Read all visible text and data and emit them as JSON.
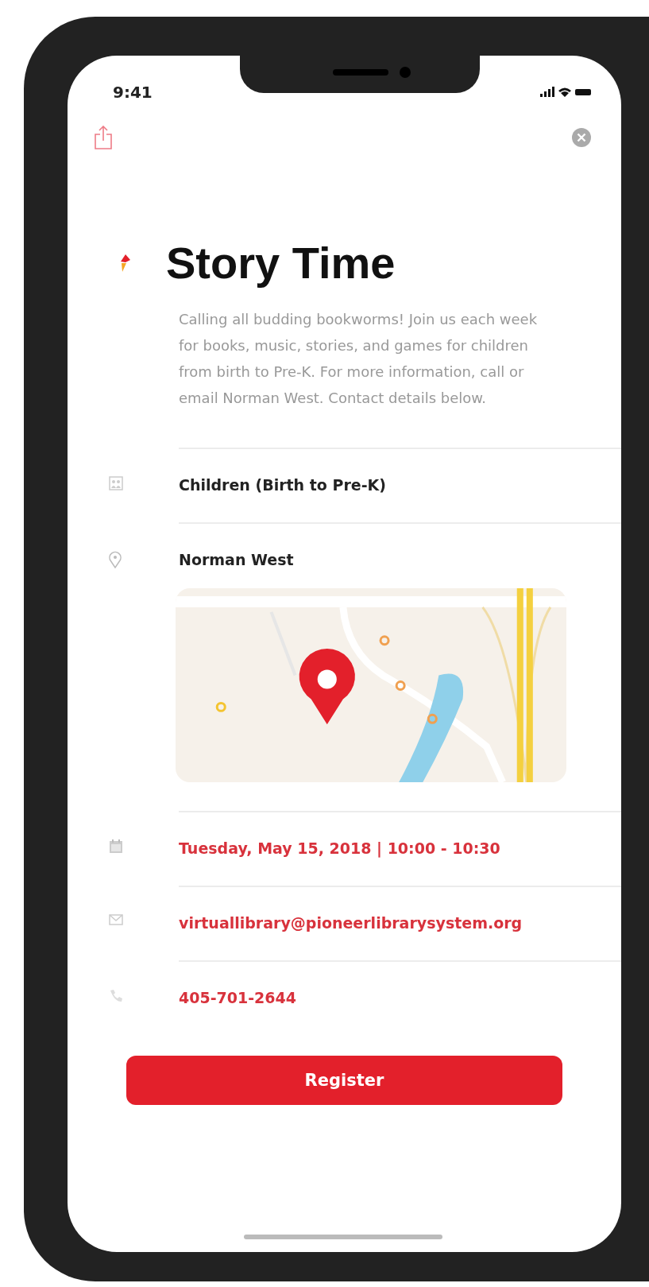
{
  "status_bar": {
    "time": "9:41"
  },
  "title": "Story Time",
  "description": "Calling all budding bookworms! Join us each week for books, music, stories, and games for children from birth to Pre-K. For more information, call or email Norman West. Contact details below.",
  "details": [
    {
      "kind": "audience",
      "text": "Children (Birth to Pre-K)"
    },
    {
      "kind": "location",
      "text": "Norman West"
    },
    {
      "kind": "date",
      "text": "Tuesday, May 15, 2018  |  10:00 - 10:30"
    },
    {
      "kind": "email",
      "text": "virtuallibrary@pioneerlibrarysystem.org"
    },
    {
      "kind": "phone",
      "text": "405-701-2644"
    }
  ],
  "register_button": "Register"
}
